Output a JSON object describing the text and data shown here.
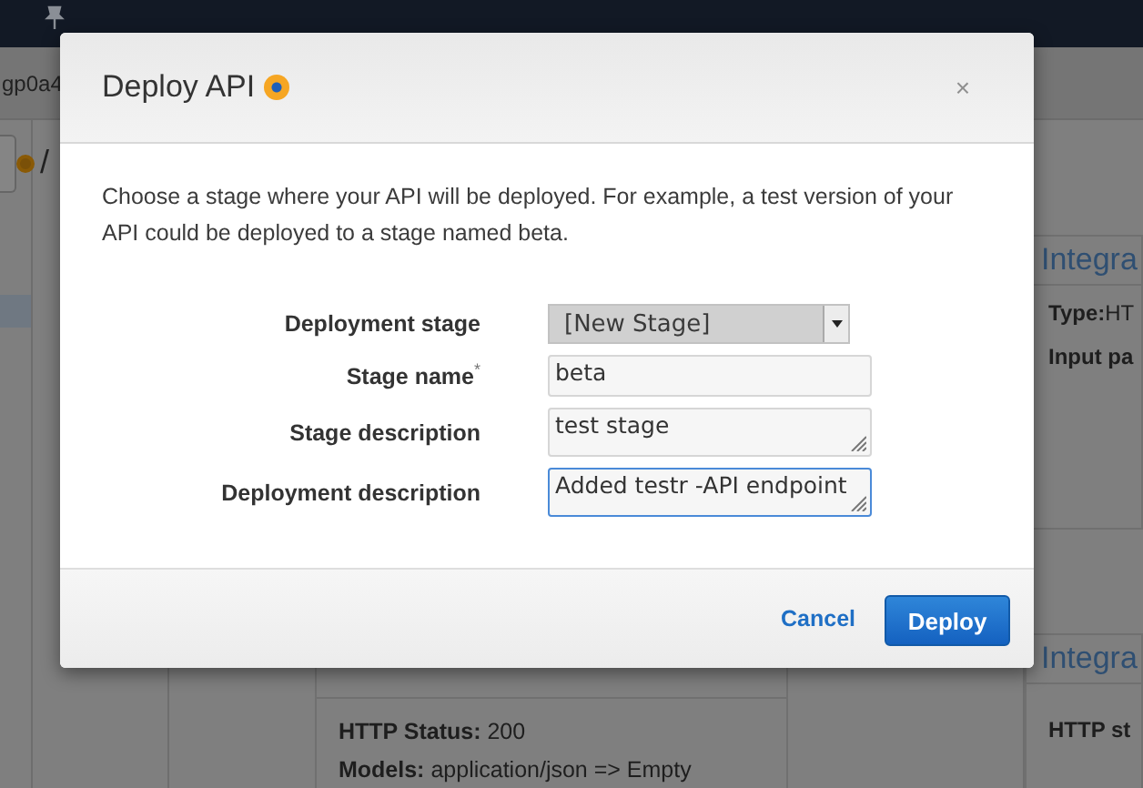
{
  "background": {
    "breadcrumb": "gp0a4",
    "path_separator": "/",
    "integration_request": {
      "title": "Integra",
      "lines": [
        {
          "label": "Type:",
          "value": "HT"
        },
        {
          "label": "Input pa"
        }
      ]
    },
    "method_response": {
      "lines": [
        {
          "label": "HTTP Status:",
          "value": "200"
        },
        {
          "label": "Models:",
          "value": "application/json => Empty"
        }
      ]
    },
    "integration_response": {
      "title": "Integra",
      "lines": [
        {
          "label": "HTTP st"
        }
      ]
    }
  },
  "dialog": {
    "title": "Deploy API",
    "close": "×",
    "intro": "Choose a stage where your API will be deployed. For example, a test version of your API could be deployed to a stage named beta.",
    "fields": [
      {
        "kind": "select",
        "label": "Deployment stage",
        "value": "[New Stage]",
        "focused": false
      },
      {
        "kind": "input",
        "label": "Stage name$^{*}$",
        "value": "beta",
        "focused": false
      },
      {
        "kind": "textarea",
        "label": "Stage description",
        "value": "test stage",
        "focused": false
      },
      {
        "kind": "textarea",
        "label": "Deployment description",
        "value": "Added testr -API endpoint",
        "focused": true
      }
    ],
    "buttons": [
      {
        "kind": "link",
        "label": "Cancel"
      },
      {
        "kind": "primary",
        "label": "Deploy"
      }
    ]
  }
}
